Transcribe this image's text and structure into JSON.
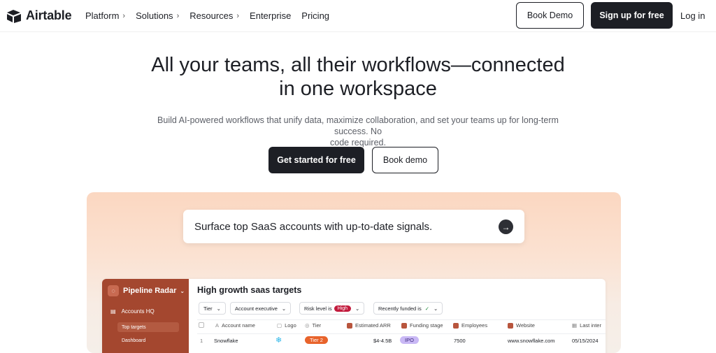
{
  "nav": {
    "brand": "Airtable",
    "menu": [
      {
        "label": "Platform",
        "chevron": "›"
      },
      {
        "label": "Solutions",
        "chevron": "›"
      },
      {
        "label": "Resources",
        "chevron": "›"
      },
      {
        "label": "Enterprise",
        "chevron": ""
      },
      {
        "label": "Pricing",
        "chevron": ""
      }
    ],
    "book_demo": "Book Demo",
    "signup": "Sign up for free",
    "login": "Log in"
  },
  "hero": {
    "title_line1": "All your teams, all their workflows—connected",
    "title_line2": "in one workspace",
    "subtitle_line1": "Build AI-powered workflows that unify data, maximize collaboration, and set your teams up for long-term success. No",
    "subtitle_line2": "code required.",
    "cta_primary": "Get started for free",
    "cta_secondary": "Book demo"
  },
  "showcase": {
    "prompt": "Surface top SaaS accounts with up-to-date signals.",
    "send_icon": "arrow-right-icon",
    "app": {
      "workspace": "Pipeline Radar",
      "sidebar": {
        "section": "Accounts HQ",
        "items": [
          "Top targets",
          "Dashboard"
        ]
      },
      "title": "High growth saas targets",
      "filters": {
        "tier": "Tier",
        "account_exec": "Account executive",
        "risk_label": "Risk level is",
        "risk_value": "High",
        "funded_label": "Recently funded is",
        "funded_check": "✓"
      },
      "columns": [
        "Account name",
        "Logo",
        "Tier",
        "Estimated ARR",
        "Funding stage",
        "Employees",
        "Website",
        "Last inter"
      ],
      "row": {
        "index": "1",
        "account": "Snowflake",
        "tier": "Tier 2",
        "arr": "$4-4.5B",
        "stage": "IPO",
        "employees": "7500",
        "website": "www.snowflake.com",
        "last": "05/15/2024"
      }
    }
  },
  "colors": {
    "dark": "#1d1f25",
    "sidebar": "#a4472f",
    "risk_high": "#c21b3d",
    "tier_pill": "#e8632b",
    "ipo_pill": "#c9b8f5"
  }
}
